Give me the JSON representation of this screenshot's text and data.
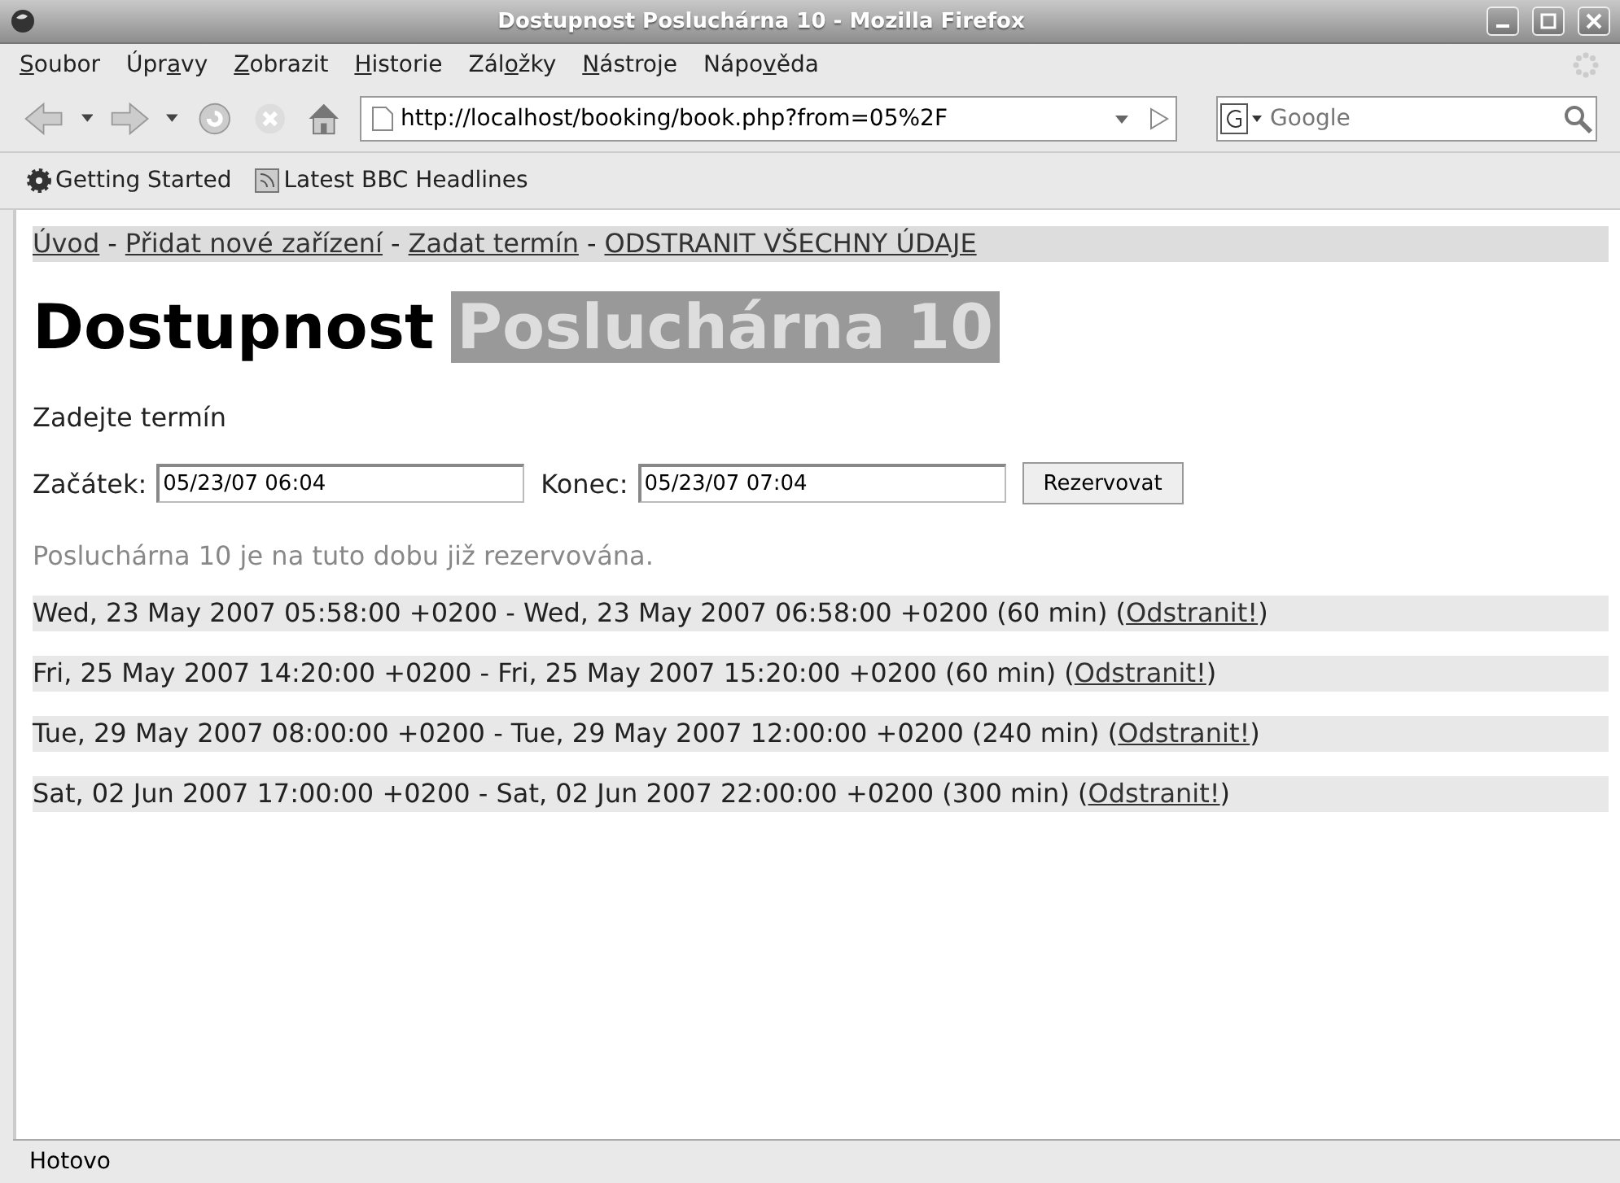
{
  "window": {
    "title": "Dostupnost Posluchárna 10 - Mozilla Firefox"
  },
  "menu": [
    {
      "key": "S",
      "post": "oubor"
    },
    {
      "pre": "Úpr",
      "key": "a",
      "post": "vy"
    },
    {
      "key": "Z",
      "post": "obrazit"
    },
    {
      "key": "H",
      "post": "istorie"
    },
    {
      "pre": "Zál",
      "key": "o",
      "post": "žky"
    },
    {
      "key": "N",
      "post": "ástroje"
    },
    {
      "pre": "Nápo",
      "key": "v",
      "post": "ěda"
    }
  ],
  "address": {
    "value": "http://localhost/booking/book.php?from=05%2F"
  },
  "search": {
    "placeholder": "Google"
  },
  "bookmarks": [
    {
      "label": "Getting Started",
      "kind": "gear"
    },
    {
      "label": "Latest BBC Headlines",
      "kind": "feed"
    }
  ],
  "nav_links": [
    "Úvod",
    "Přidat nové zařízení",
    "Zadat termín",
    "ODSTRANIT VŠECHNY ÚDAJE"
  ],
  "nav_separator": "-",
  "heading": {
    "main": "Dostupnost",
    "room": "Posluchárna 10"
  },
  "form_title": "Zadejte termín",
  "form": {
    "start_label": "Začátek:",
    "start_value": "05/23/07 06:04",
    "end_label": "Konec:",
    "end_value": "05/23/07 07:04",
    "submit": "Rezervovat"
  },
  "message": "Posluchárna 10 je na tuto dobu již rezervována.",
  "bookings": [
    {
      "text": "Wed, 23 May 2007 05:58:00 +0200 - Wed, 23 May 2007 06:58:00 +0200 (60 min) (",
      "link": "Odstranit!",
      "close": ")"
    },
    {
      "text": "Fri, 25 May 2007 14:20:00 +0200 - Fri, 25 May 2007 15:20:00 +0200 (60 min) (",
      "link": "Odstranit!",
      "close": ")"
    },
    {
      "text": "Tue, 29 May 2007 08:00:00 +0200 - Tue, 29 May 2007 12:00:00 +0200 (240 min) (",
      "link": "Odstranit!",
      "close": ")"
    },
    {
      "text": "Sat, 02 Jun 2007 17:00:00 +0200 - Sat, 02 Jun 2007 22:00:00 +0200 (300 min) (",
      "link": "Odstranit!",
      "close": ")"
    }
  ],
  "status_bar": "Hotovo"
}
